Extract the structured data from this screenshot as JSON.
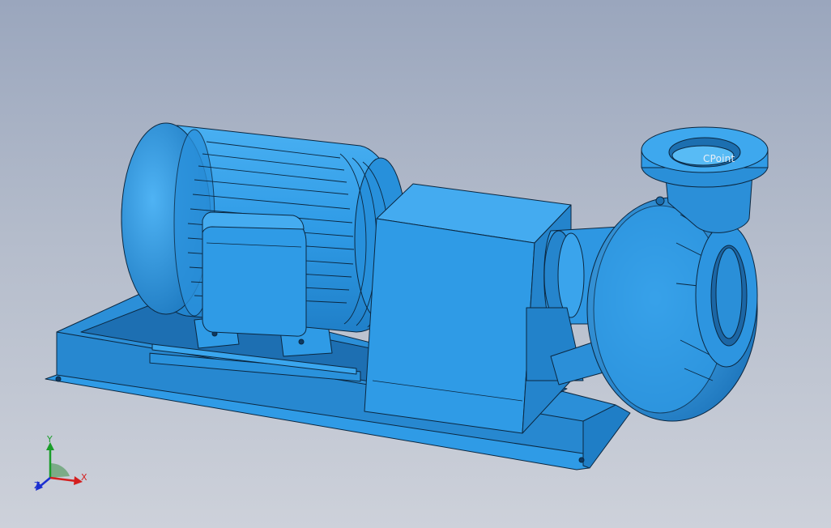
{
  "viewport": {
    "background_top": "#9aa6bd",
    "background_bottom": "#cdd1da"
  },
  "model": {
    "body_color": "#2f9be6",
    "edge_color": "#0b2740",
    "shadow_color": "#1c6fb0"
  },
  "annotations": {
    "cpoint_label": "CPoint"
  },
  "triad": {
    "x_label": "X",
    "y_label": "Y",
    "z_label": "Z",
    "x_color": "#d41f1f",
    "y_color": "#1a9d2a",
    "z_color": "#1b2fd0"
  }
}
